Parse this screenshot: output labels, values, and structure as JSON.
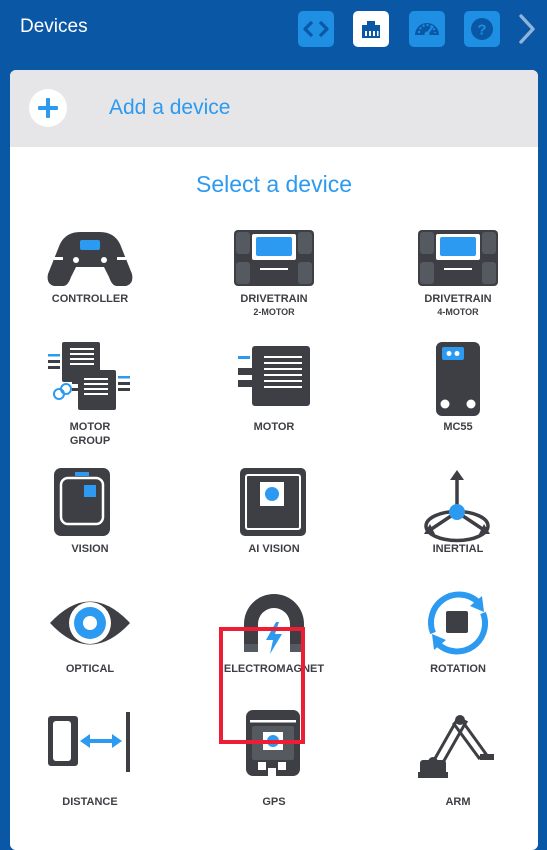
{
  "header": {
    "title": "Devices",
    "buttons": [
      {
        "name": "code-icon",
        "active": false
      },
      {
        "name": "devices-port-icon",
        "active": true
      },
      {
        "name": "dashboard-gauge-icon",
        "active": false
      },
      {
        "name": "help-icon",
        "active": false
      }
    ],
    "collapse": "chevron-right-icon"
  },
  "add_device": {
    "label": "Add a device",
    "icon": "plus-icon"
  },
  "select_title": "Select a device",
  "devices": [
    {
      "label": "CONTROLLER",
      "sub": "",
      "icon": "controller-icon"
    },
    {
      "label": "DRIVETRAIN",
      "sub": "2-MOTOR",
      "icon": "drivetrain-2-motor-icon"
    },
    {
      "label": "DRIVETRAIN",
      "sub": "4-MOTOR",
      "icon": "drivetrain-4-motor-icon"
    },
    {
      "label": "MOTOR",
      "sub": "GROUP",
      "icon": "motor-group-icon"
    },
    {
      "label": "MOTOR",
      "sub": "",
      "icon": "motor-icon"
    },
    {
      "label": "MC55",
      "sub": "",
      "icon": "mc55-icon"
    },
    {
      "label": "VISION",
      "sub": "",
      "icon": "vision-sensor-icon"
    },
    {
      "label": "AI VISION",
      "sub": "",
      "icon": "ai-vision-sensor-icon"
    },
    {
      "label": "INERTIAL",
      "sub": "",
      "icon": "inertial-sensor-icon"
    },
    {
      "label": "OPTICAL",
      "sub": "",
      "icon": "optical-eye-icon"
    },
    {
      "label": "ELECTROMAGNET",
      "sub": "",
      "icon": "electromagnet-icon"
    },
    {
      "label": "ROTATION",
      "sub": "",
      "icon": "rotation-sensor-icon"
    },
    {
      "label": "DISTANCE",
      "sub": "",
      "icon": "distance-sensor-icon"
    },
    {
      "label": "GPS",
      "sub": "",
      "icon": "gps-sensor-icon",
      "selected": true
    },
    {
      "label": "ARM",
      "sub": "",
      "icon": "robot-arm-icon"
    }
  ],
  "colors": {
    "header": "#0a57a6",
    "accent": "#2b9af0",
    "icon_dark": "#3d3f44",
    "selection": "#ee1d36"
  }
}
